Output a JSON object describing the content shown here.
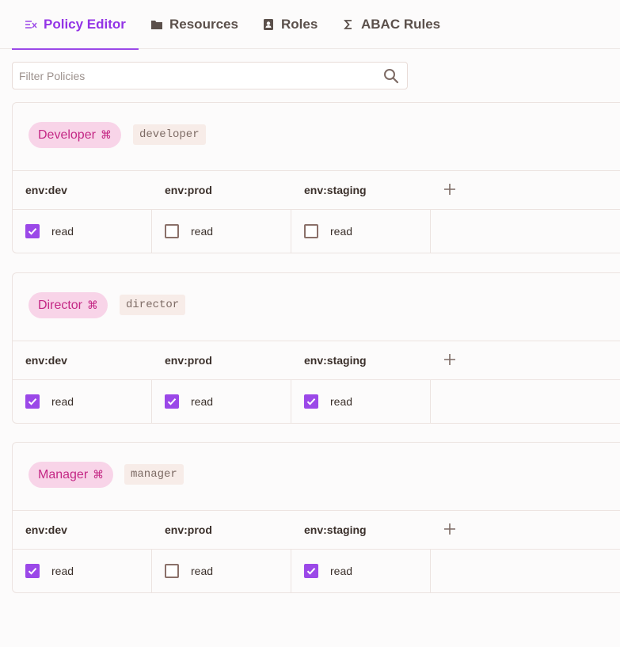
{
  "tabs": [
    {
      "label": "Policy Editor",
      "icon": "policy-editor-icon",
      "active": true
    },
    {
      "label": "Resources",
      "icon": "folder-icon",
      "active": false
    },
    {
      "label": "Roles",
      "icon": "roles-icon",
      "active": false
    },
    {
      "label": "ABAC Rules",
      "icon": "sigma-icon",
      "active": false
    }
  ],
  "filter": {
    "placeholder": "Filter Policies",
    "value": ""
  },
  "policies": [
    {
      "name": "Developer",
      "key": "developer",
      "columns": [
        "env:dev",
        "env:prod",
        "env:staging"
      ],
      "action": "read",
      "checked": [
        true,
        false,
        false
      ]
    },
    {
      "name": "Director",
      "key": "director",
      "columns": [
        "env:dev",
        "env:prod",
        "env:staging"
      ],
      "action": "read",
      "checked": [
        true,
        true,
        true
      ]
    },
    {
      "name": "Manager",
      "key": "manager",
      "columns": [
        "env:dev",
        "env:prod",
        "env:staging"
      ],
      "action": "read",
      "checked": [
        true,
        false,
        true
      ]
    }
  ],
  "colors": {
    "accent": "#9b48e8",
    "pill_bg": "#f8d4e8",
    "pill_text": "#c42885"
  }
}
